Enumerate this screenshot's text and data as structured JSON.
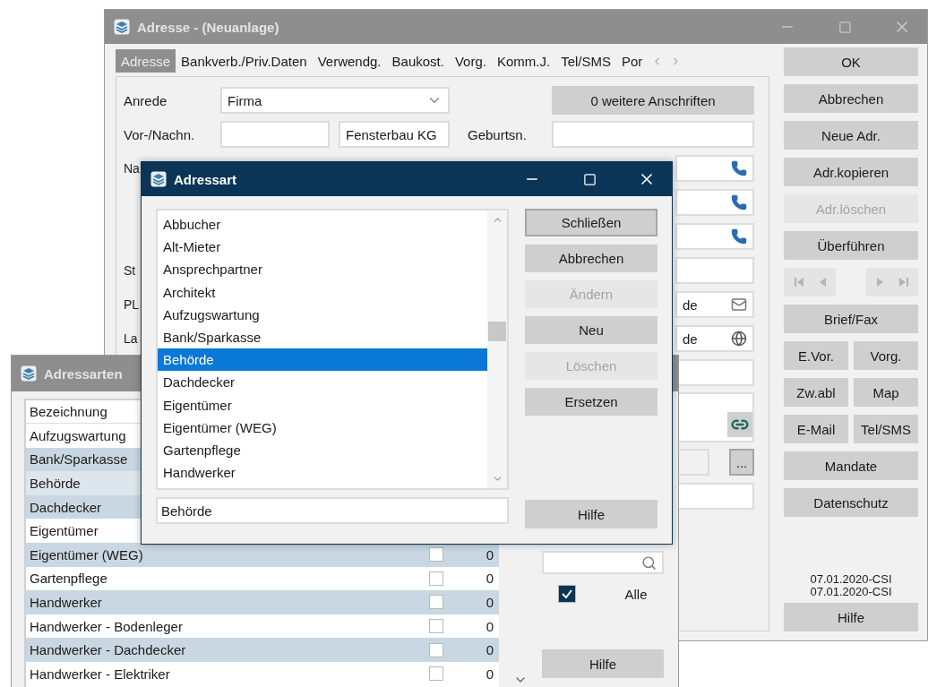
{
  "main_window": {
    "title": "Adresse - (Neuanlage)",
    "tabs": [
      {
        "label": "Adresse",
        "selected": true
      },
      {
        "label": "Bankverb./Priv.Daten",
        "selected": false
      },
      {
        "label": "Verwendg.",
        "selected": false
      },
      {
        "label": "Baukost.",
        "selected": false
      },
      {
        "label": "Vorg.",
        "selected": false
      },
      {
        "label": "Komm.J.",
        "selected": false
      },
      {
        "label": "Tel/SMS",
        "selected": false
      },
      {
        "label": "Por",
        "selected": false
      }
    ],
    "form": {
      "salutation_label": "Anrede",
      "salutation_value": "Firma",
      "name_label": "Vor-/Nachn.",
      "last_name": "Fensterbau KG",
      "birth_name_label": "Geburtsn.",
      "more_addresses_button": "0 weitere Anschriften",
      "rows": [
        {
          "label": "Na",
          "kind": "phone"
        },
        {
          "kind": "phone"
        },
        {
          "kind": "phone"
        },
        {
          "label": "St",
          "kind": "plain"
        },
        {
          "label": "PL",
          "kind": "mail",
          "value": "de"
        },
        {
          "label": "La",
          "kind": "web",
          "value": "de"
        },
        {
          "kind": "plain"
        },
        {
          "kind": "link"
        },
        {
          "kind": "browse",
          "button": "..."
        },
        {
          "kind": "plain"
        }
      ]
    },
    "side_buttons": [
      {
        "kind": "wide",
        "label": "OK",
        "disabled": false
      },
      {
        "kind": "wide",
        "label": "Abbrechen",
        "disabled": false
      },
      {
        "kind": "wide",
        "label": "Neue Adr.",
        "disabled": false
      },
      {
        "kind": "wide",
        "label": "Adr.kopieren",
        "disabled": false
      },
      {
        "kind": "wide",
        "label": "Adr.löschen",
        "disabled": true
      },
      {
        "kind": "wide",
        "label": "Überführen",
        "disabled": false
      },
      {
        "kind": "nav",
        "disabled": true
      },
      {
        "kind": "wide",
        "label": "Brief/Fax",
        "disabled": false
      },
      {
        "kind": "pair",
        "labels": [
          "E.Vor.",
          "Vorg."
        ],
        "disabled": false
      },
      {
        "kind": "pair",
        "labels": [
          "Zw.abl",
          "Map"
        ],
        "disabled": false
      },
      {
        "kind": "pair",
        "labels": [
          "E-Mail",
          "Tel/SMS"
        ],
        "disabled": false
      },
      {
        "kind": "wide",
        "label": "Mandate",
        "disabled": false
      },
      {
        "kind": "wide",
        "label": "Datenschutz",
        "disabled": false
      }
    ],
    "stamps": [
      "07.01.2020-CSI",
      "07.01.2020-CSI"
    ],
    "help_button": "Hilfe"
  },
  "types_window": {
    "title": "Adressarten",
    "column_header": "Bezeichnung",
    "rows": [
      {
        "name": "Aufzugswartung",
        "selected": false
      },
      {
        "name": "Bank/Sparkasse",
        "selected": false
      },
      {
        "name": "Behörde",
        "selected": true
      },
      {
        "name": "Dachdecker",
        "selected": false
      },
      {
        "name": "Eigentümer",
        "selected": false
      },
      {
        "name": "Eigentümer (WEG)",
        "selected": false,
        "checked": false,
        "count": "0"
      },
      {
        "name": "Gartenpflege",
        "selected": false,
        "checked": false,
        "count": "0"
      },
      {
        "name": "Handwerker",
        "selected": false,
        "checked": false,
        "count": "0"
      },
      {
        "name": "Handwerker - Bodenleger",
        "selected": false,
        "checked": false,
        "count": "0"
      },
      {
        "name": "Handwerker - Dachdecker",
        "selected": false,
        "checked": false,
        "count": "0"
      },
      {
        "name": "Handwerker - Elektriker",
        "selected": false,
        "checked": false,
        "count": "0"
      }
    ],
    "all_checkbox": {
      "label": "Alle",
      "checked": true
    },
    "help_button": "Hilfe"
  },
  "dialog": {
    "title": "Adressart",
    "items": [
      {
        "label": "Abbucher",
        "selected": false
      },
      {
        "label": "Alt-Mieter",
        "selected": false
      },
      {
        "label": "Ansprechpartner",
        "selected": false
      },
      {
        "label": "Architekt",
        "selected": false
      },
      {
        "label": "Aufzugswartung",
        "selected": false
      },
      {
        "label": "Bank/Sparkasse",
        "selected": false
      },
      {
        "label": "Behörde",
        "selected": true
      },
      {
        "label": "Dachdecker",
        "selected": false
      },
      {
        "label": "Eigentümer",
        "selected": false
      },
      {
        "label": "Eigentümer (WEG)",
        "selected": false
      },
      {
        "label": "Gartenpflege",
        "selected": false
      },
      {
        "label": "Handwerker",
        "selected": false
      }
    ],
    "input_value": "Behörde",
    "buttons": [
      {
        "label": "Schließen",
        "disabled": false,
        "default": true
      },
      {
        "label": "Abbrechen",
        "disabled": false,
        "default": false
      },
      {
        "label": "Ändern",
        "disabled": true,
        "default": false
      },
      {
        "label": "Neu",
        "disabled": false,
        "default": false
      },
      {
        "label": "Löschen",
        "disabled": true,
        "default": false
      },
      {
        "label": "Ersetzen",
        "disabled": false,
        "default": false
      }
    ],
    "help_button": "Hilfe"
  }
}
